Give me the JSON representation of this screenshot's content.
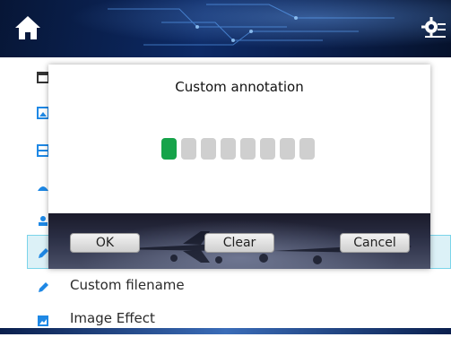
{
  "header": {
    "home_icon": "home-icon",
    "settings_icon": "settings-gear-icon"
  },
  "menu": {
    "items": [
      {
        "icon": "calendar-icon",
        "label": ""
      },
      {
        "icon": "image-map-icon",
        "label": ""
      },
      {
        "icon": "list-icon",
        "label": ""
      },
      {
        "icon": "signal-icon",
        "label": ""
      },
      {
        "icon": "person-icon",
        "label": ""
      },
      {
        "icon": "pencil-icon",
        "label": ""
      },
      {
        "icon": "pencil-icon",
        "label": "Custom filename"
      },
      {
        "icon": "image-icon",
        "label": "Image Effect"
      }
    ]
  },
  "dialog": {
    "title": "Custom annotation",
    "code_boxes": 8,
    "active_box": 0,
    "buttons": {
      "ok": "OK",
      "clear": "Clear",
      "cancel": "Cancel"
    }
  },
  "colors": {
    "accent": "#1e88e5",
    "active_box": "#16a34a",
    "inactive_box": "#cfcfcf",
    "selected_row": "#dcf1f7"
  }
}
